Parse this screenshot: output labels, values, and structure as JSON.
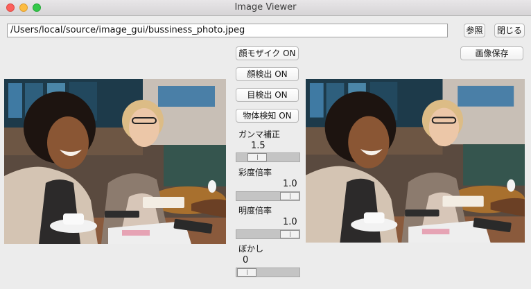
{
  "window": {
    "title": "Image Viewer"
  },
  "path": {
    "value": "/Users/local/source/image_gui/bussiness_photo.jpeg"
  },
  "buttons": {
    "browse": "参照",
    "close": "閉じる",
    "save": "画像保存",
    "face_mosaic": "顔モザイク ON",
    "face_detect": "顔検出 ON",
    "eye_detect": "目検出 ON",
    "object_detect": "物体検知 ON"
  },
  "sliders": {
    "gamma": {
      "label": "ガンマ補正",
      "value": "1.5"
    },
    "saturation": {
      "label": "彩度倍率",
      "value": "1.0"
    },
    "brightness": {
      "label": "明度倍率",
      "value": "1.0"
    },
    "blur": {
      "label": "ぼかし",
      "value": "0"
    }
  },
  "images": {
    "original": {
      "icon": "photo-original"
    },
    "processed": {
      "icon": "photo-processed"
    }
  },
  "colors": {
    "titlebar": "#dcdadc",
    "close": "#fc605c",
    "minimize": "#fdbc40",
    "maximize": "#34c84a"
  }
}
